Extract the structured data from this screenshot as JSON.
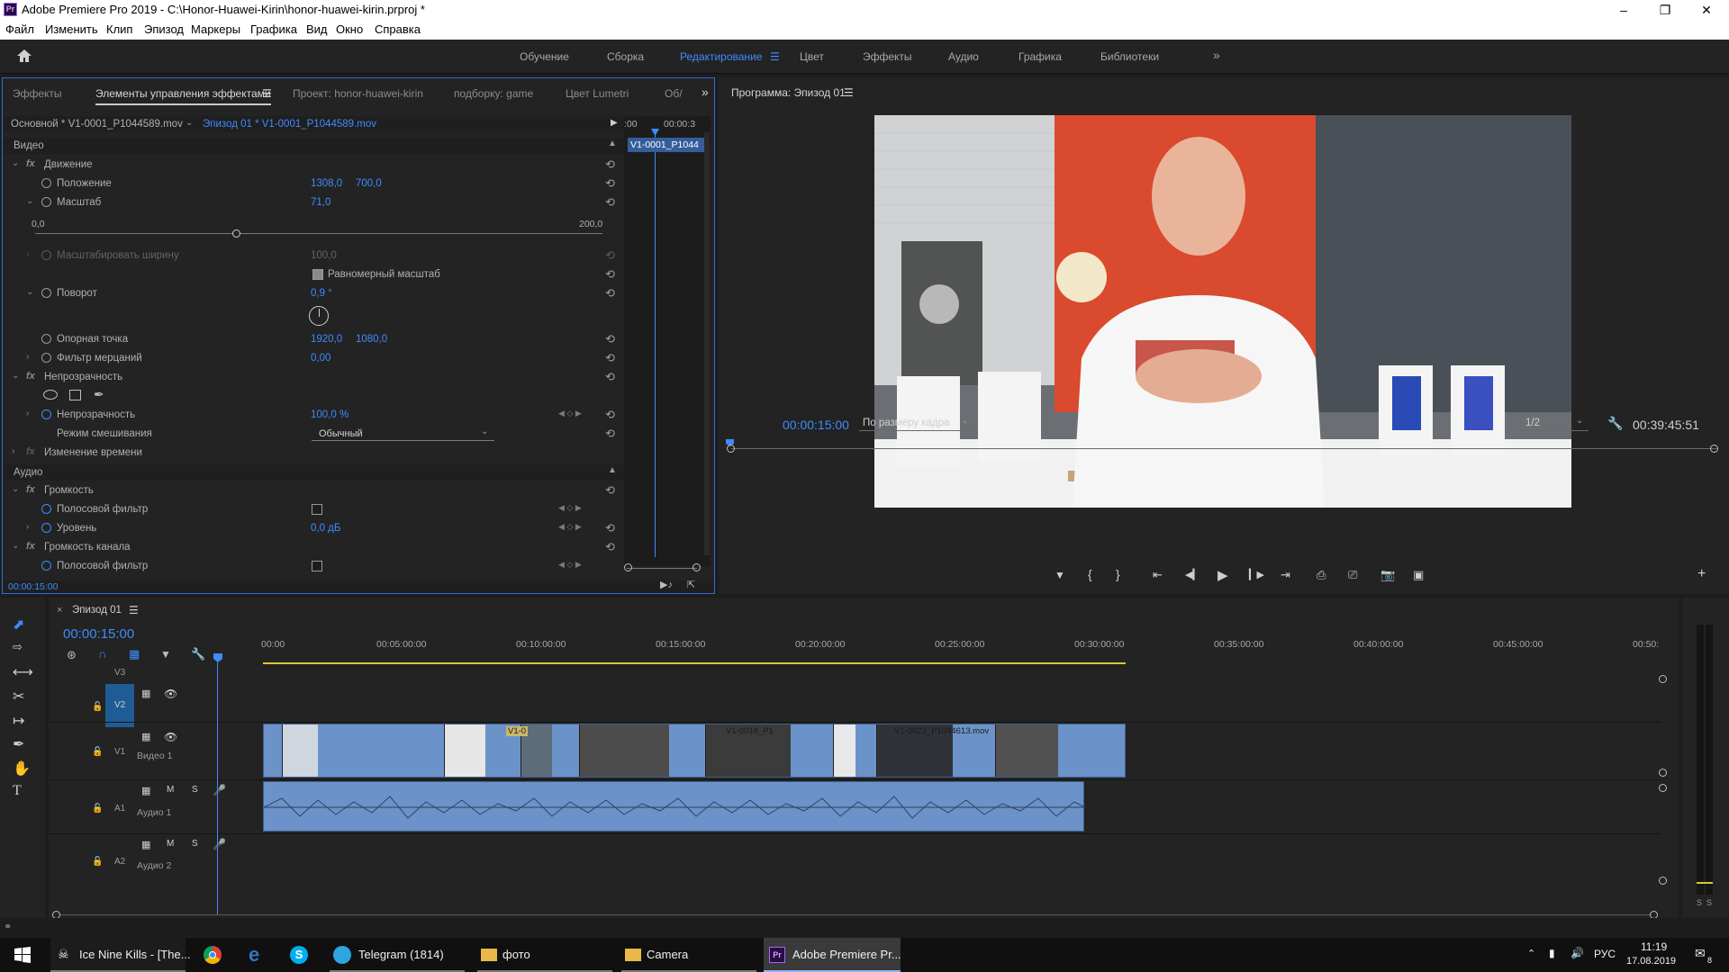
{
  "window": {
    "title": "Adobe Premiere Pro 2019 - C:\\Honor-Huawei-Kirin\\honor-huawei-kirin.prproj *",
    "logo": "Pr"
  },
  "menu": [
    "Файл",
    "Изменить",
    "Клип",
    "Эпизод",
    "Маркеры",
    "Графика",
    "Вид",
    "Окно",
    "Справка"
  ],
  "workspaces": [
    {
      "label": "Обучение",
      "active": false
    },
    {
      "label": "Сборка",
      "active": false
    },
    {
      "label": "Редактирование",
      "active": true
    },
    {
      "label": "Цвет",
      "active": false
    },
    {
      "label": "Эффекты",
      "active": false
    },
    {
      "label": "Аудио",
      "active": false
    },
    {
      "label": "Графика",
      "active": false
    },
    {
      "label": "Библиотеки",
      "active": false
    }
  ],
  "effects_panel": {
    "tabs": [
      "Эффекты",
      "Элементы управления эффектами",
      "Проект: honor-huawei-kirin",
      "подборку: game",
      "Цвет Lumetri",
      "Об/"
    ],
    "master_clip": "Основной * V1-0001_P1044589.mov",
    "sequence_clip": "Эпизод 01 * V1-0001_P1044589.mov",
    "mini_timeline": {
      "t_start": ":00",
      "t_end": "00:00:3",
      "clip_label": "V1-0001_P1044"
    },
    "section_video": "Видео",
    "section_audio": "Аудио",
    "motion": "Движение",
    "position": {
      "label": "Положение",
      "x": "1308,0",
      "y": "700,0"
    },
    "scale": {
      "label": "Масштаб",
      "value": "71,0",
      "min": "0,0",
      "max": "200,0"
    },
    "scale_width": {
      "label": "Масштабировать ширину",
      "value": "100,0"
    },
    "uniform_scale": "Равномерный масштаб",
    "rotation": {
      "label": "Поворот",
      "value": "0,9 °"
    },
    "anchor": {
      "label": "Опорная точка",
      "x": "1920,0",
      "y": "1080,0"
    },
    "flicker": {
      "label": "Фильтр мерцаний",
      "value": "0,00"
    },
    "opacity_group": "Непрозрачность",
    "opacity": {
      "label": "Непрозрачность",
      "value": "100,0 %"
    },
    "blend": {
      "label": "Режим смешивания",
      "value": "Обычный"
    },
    "time_remap": "Изменение времени",
    "volume": "Громкость",
    "bypass": "Полосовой фильтр",
    "level": {
      "label": "Уровень",
      "value": "0,0 дБ"
    },
    "channel_volume": "Громкость канала",
    "bypass2": "Полосовой фильтр",
    "timecode": "00:00:15:00"
  },
  "program_monitor": {
    "title": "Программа: Эпизод 01",
    "timecode": "00:00:15:00",
    "fit": "По размеру кадра",
    "resolution": "1/2",
    "duration": "00:39:45:51"
  },
  "timeline": {
    "tab": "Эпизод 01",
    "timecode": "00:00:15:00",
    "ruler": [
      "00:00",
      "00:05:00:00",
      "00:10:00:00",
      "00:15:00:00",
      "00:20:00:00",
      "00:25:00:00",
      "00:30:00:00",
      "00:35:00:00",
      "00:40:00:00",
      "00:45:00:00",
      "00:50:"
    ],
    "tracks": {
      "v3": "V3",
      "v2": "V2",
      "v1": "V1",
      "v1_name": "Видео 1",
      "a1": "A1",
      "a1_name": "Аудио 1",
      "a2": "A2",
      "a2_name": "Аудио 2",
      "m": "M",
      "s": "S"
    },
    "clip_labels": [
      "V1-0",
      "V1-0018_P1",
      "V1-0023_P1044613.mov"
    ]
  },
  "vu": {
    "labels": [
      "S",
      "S"
    ]
  },
  "taskbar": {
    "items": [
      {
        "label": "Ice Nine Kills - [The..."
      },
      {
        "label": "Telegram (1814)"
      },
      {
        "label": "фото"
      },
      {
        "label": "Camera"
      },
      {
        "label": "Adobe Premiere Pr..."
      }
    ],
    "lang": "РУС",
    "time": "11:19",
    "date": "17.08.2019",
    "notif": "8"
  },
  "colors": {
    "accent": "#3d8cff",
    "clip_blue": "#6b93c9",
    "yellow": "#d9c832",
    "panel": "#232323"
  }
}
